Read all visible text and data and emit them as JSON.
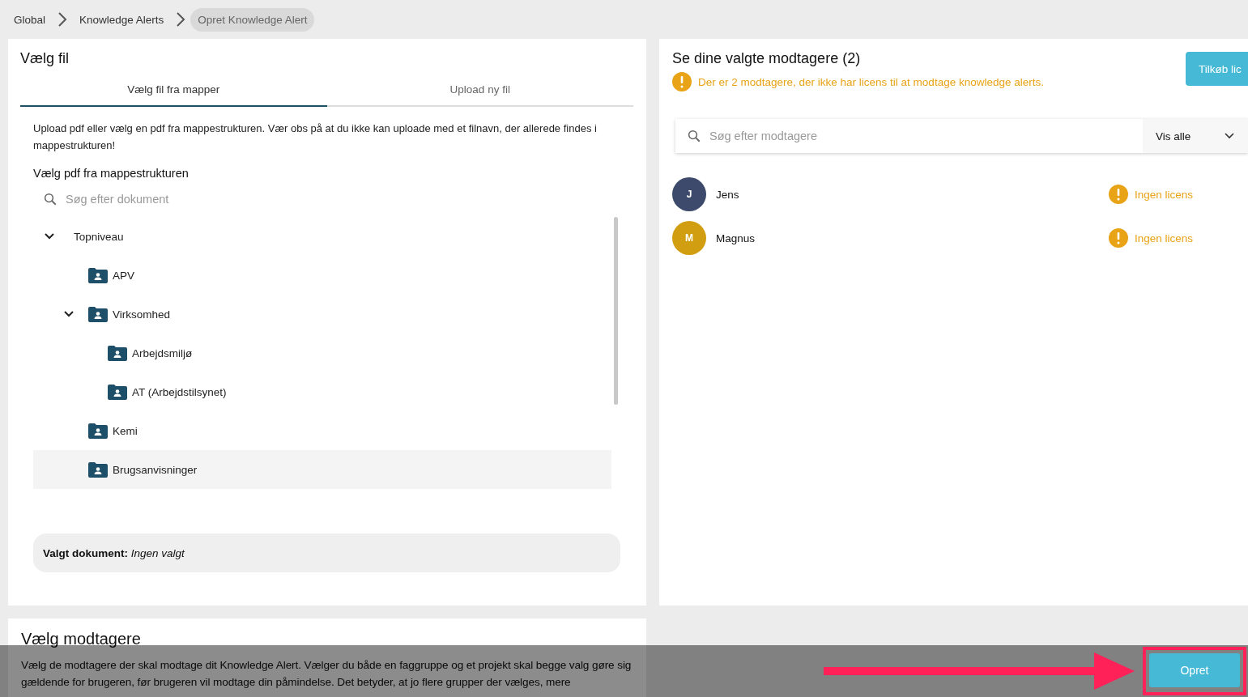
{
  "breadcrumbs": [
    {
      "label": "Global",
      "selected": false
    },
    {
      "label": "Knowledge Alerts",
      "selected": false
    },
    {
      "label": "Opret Knowledge Alert",
      "selected": true
    }
  ],
  "file_card": {
    "title": "Vælg fil",
    "tabs": [
      {
        "label": "Vælg fil fra mapper",
        "selected": true
      },
      {
        "label": "Upload ny fil",
        "selected": false
      }
    ],
    "intro": "Upload pdf eller vælg en pdf fra mappestrukturen. Vær obs på at du ikke kan uploade med et filnavn, der allerede findes i mappestrukturen!",
    "section_title": "Vælg pdf fra mappestrukturen",
    "search": {
      "placeholder": "Søg efter dokument"
    },
    "tree": [
      {
        "label": "Topniveau",
        "expanded": true,
        "children": [
          {
            "label": "APV",
            "selected": false
          },
          {
            "label": "Virksomhed",
            "expanded": true,
            "children": [
              {
                "label": "Arbejdsmiljø",
                "selected": false
              },
              {
                "label": "AT (Arbejdstilsynet)",
                "selected": false
              }
            ]
          },
          {
            "label": "Kemi",
            "selected": false
          },
          {
            "label": "Brugsanvisninger",
            "selected": true
          }
        ]
      }
    ],
    "selected_document": {
      "label": "Valgt dokument:",
      "value": "Ingen valgt"
    }
  },
  "recipients_card": {
    "title": "Se dine valgte modtagere (2)",
    "warning": "Der er 2 modtagere, der ikke har licens til at modtage knowledge alerts.",
    "buy_button": "Tilkøb lic",
    "search": {
      "placeholder": "Søg efter modtagere"
    },
    "filter": "Vis alle",
    "recipients": [
      {
        "initial": "J",
        "name": "Jens",
        "color": "#3d4a6b",
        "status": "Ingen licens"
      },
      {
        "initial": "M",
        "name": "Magnus",
        "color": "#d19e12",
        "status": "Ingen licens"
      }
    ]
  },
  "recipients_section": {
    "title": "Vælg modtagere",
    "description": "Vælg de modtagere der skal modtage dit Knowledge Alert. Vælger du både en faggruppe og et projekt skal begge valg gøre sig gældende for brugeren, før brugeren vil modtage din påmindelse. Det betyder, at jo flere grupper der vælges, mere"
  },
  "footer": {
    "button": "Opret"
  }
}
